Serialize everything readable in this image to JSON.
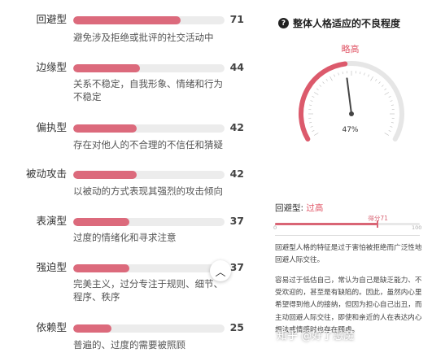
{
  "traits": [
    {
      "name": "回避型",
      "score": "71",
      "desc": [
        "避免涉及拒绝或批评的社交活动中"
      ]
    },
    {
      "name": "边缘型",
      "score": "44",
      "desc": [
        "关系不稳定，自我形象、情绪和行为",
        "不稳定"
      ]
    },
    {
      "name": "偏执型",
      "score": "42",
      "desc": [
        "存在对他人的不合理的不信任和猜疑"
      ]
    },
    {
      "name": "被动攻击",
      "score": "42",
      "desc": [
        "以被动的方式表现其强烈的攻击倾向"
      ]
    },
    {
      "name": "表演型",
      "score": "37",
      "desc": [
        "过度的情绪化和寻求注意"
      ]
    },
    {
      "name": "强迫型",
      "score": "37",
      "desc": [
        "完美主义，过分专注于规则、细节、",
        "程序、秩序"
      ]
    },
    {
      "name": "依赖型",
      "score": "25",
      "desc": [
        "普遍的、过度的需要被照顾"
      ]
    }
  ],
  "collapse_icon": "chevron-up-icon",
  "overall": {
    "title": "整体人格适应的不良程度",
    "icon": "info-icon",
    "level": "略高",
    "percent_label": "47%",
    "percent": 47
  },
  "selected": {
    "type_label": "回避型:",
    "level": "过高",
    "marker_label": "得分71",
    "score": 71,
    "min": "0",
    "max": "100",
    "para1": "回避型人格的特征是过于害怕被拒绝而广泛性地回避人际交往。",
    "para2": "容易过于低估自己，常认为自己是缺乏能力、不受欢迎的，甚至是有缺陷的。因此，虽然内心里希望得到他人的接纳，但因为担心自己出丑，而主动回避人际交往，即使和亲近的人在表达内心想法或情感时也存在顾虑。"
  },
  "watermark": "知乎 @好了恶魔",
  "colors": {
    "accent": "#dc6a7c",
    "level": "#e05566"
  }
}
